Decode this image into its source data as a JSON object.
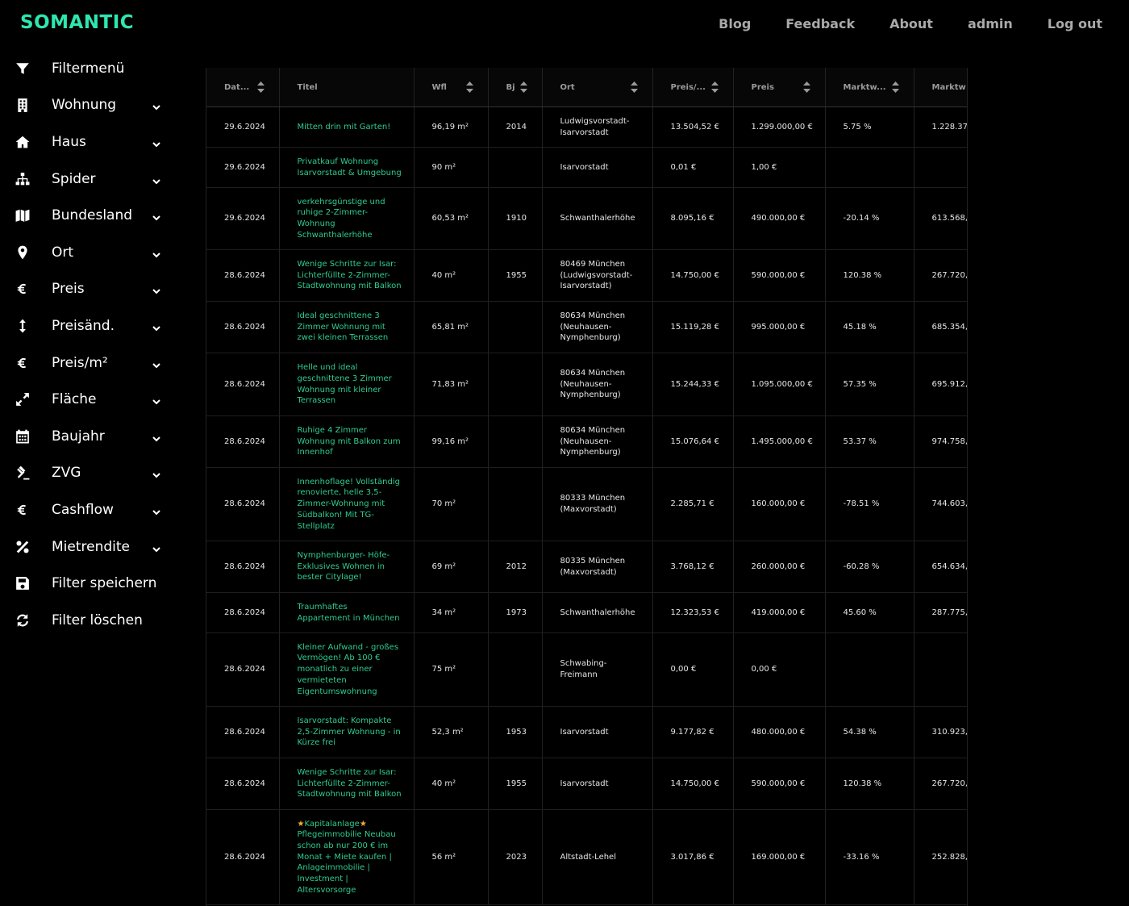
{
  "brand": "SOMANTIC",
  "nav": [
    "Blog",
    "Feedback",
    "About",
    "admin",
    "Log out"
  ],
  "sidebar": [
    {
      "label": "Filtermenü",
      "icon": "filter-icon",
      "chevron": false
    },
    {
      "label": "Wohnung",
      "icon": "building-icon",
      "chevron": true
    },
    {
      "label": "Haus",
      "icon": "home-icon",
      "chevron": true
    },
    {
      "label": "Spider",
      "icon": "sitemap-icon",
      "chevron": true
    },
    {
      "label": "Bundesland",
      "icon": "map-icon",
      "chevron": true
    },
    {
      "label": "Ort",
      "icon": "map-pin-icon",
      "chevron": true
    },
    {
      "label": "Preis",
      "icon": "euro-icon",
      "chevron": true
    },
    {
      "label": "Preisänd.",
      "icon": "arrows-vertical-icon",
      "chevron": true
    },
    {
      "label": "Preis/m²",
      "icon": "euro-icon",
      "chevron": true
    },
    {
      "label": "Fläche",
      "icon": "expand-icon",
      "chevron": true
    },
    {
      "label": "Baujahr",
      "icon": "calendar-icon",
      "chevron": true
    },
    {
      "label": "ZVG",
      "icon": "gavel-icon",
      "chevron": true
    },
    {
      "label": "Cashflow",
      "icon": "euro-icon",
      "chevron": true
    },
    {
      "label": "Mietrendite",
      "icon": "percent-icon",
      "chevron": true
    },
    {
      "label": "Filter speichern",
      "icon": "save-icon",
      "chevron": false
    },
    {
      "label": "Filter löschen",
      "icon": "refresh-icon",
      "chevron": false
    }
  ],
  "table": {
    "columns": [
      {
        "label": "Dat...",
        "sortable": true
      },
      {
        "label": "Titel",
        "sortable": false
      },
      {
        "label": "Wfl",
        "sortable": true
      },
      {
        "label": "Bj",
        "sortable": true
      },
      {
        "label": "Ort",
        "sortable": true
      },
      {
        "label": "Preis/...",
        "sortable": true
      },
      {
        "label": "Preis",
        "sortable": true
      },
      {
        "label": "Marktw...",
        "sortable": true
      },
      {
        "label": "Marktw",
        "sortable": false
      }
    ],
    "rows": [
      [
        "29.6.2024",
        "Mitten drin mit Garten!",
        "96,19 m²",
        "2014",
        "Ludwigsvorstadt-Isarvorstadt",
        "13.504,52 €",
        "1.299.000,00 €",
        "5.75 %",
        "1.228.37"
      ],
      [
        "29.6.2024",
        "Privatkauf Wohnung Isarvorstadt & Umgebung",
        "90 m²",
        "",
        "Isarvorstadt",
        "0,01 €",
        "1,00 €",
        "",
        ""
      ],
      [
        "29.6.2024",
        "verkehrsgünstige und ruhige 2-Zimmer-Wohnung Schwanthalerhöhe",
        "60,53 m²",
        "1910",
        "Schwanthalerhöhe",
        "8.095,16 €",
        "490.000,00 €",
        "-20.14 %",
        "613.568,"
      ],
      [
        "28.6.2024",
        "Wenige Schritte zur Isar: Lichterfüllte 2-Zimmer-Stadtwohnung mit Balkon",
        "40 m²",
        "1955",
        "80469 München (Ludwigsvorstadt-Isarvorstadt)",
        "14.750,00 €",
        "590.000,00 €",
        "120.38 %",
        "267.720,"
      ],
      [
        "28.6.2024",
        "Ideal geschnittene 3 Zimmer Wohnung mit zwei kleinen Terrassen",
        "65,81 m²",
        "",
        "80634 München (Neuhausen-Nymphenburg)",
        "15.119,28 €",
        "995.000,00 €",
        "45.18 %",
        "685.354,"
      ],
      [
        "28.6.2024",
        "Helle und ideal geschnittene 3 Zimmer Wohnung mit kleiner Terrassen",
        "71,83 m²",
        "",
        "80634 München (Neuhausen-Nymphenburg)",
        "15.244,33 €",
        "1.095.000,00 €",
        "57.35 %",
        "695.912,"
      ],
      [
        "28.6.2024",
        "Ruhige 4 Zimmer Wohnung mit Balkon zum Innenhof",
        "99,16 m²",
        "",
        "80634 München (Neuhausen-Nymphenburg)",
        "15.076,64 €",
        "1.495.000,00 €",
        "53.37 %",
        "974.758,"
      ],
      [
        "28.6.2024",
        "Innenhoflage! Vollständig renovierte, helle 3,5-Zimmer-Wohnung mit Südbalkon! Mit TG-Stellplatz",
        "70 m²",
        "",
        "80333 München (Maxvorstadt)",
        "2.285,71 €",
        "160.000,00 €",
        "-78.51 %",
        "744.603,"
      ],
      [
        "28.6.2024",
        "Nymphenburger- Höfe- Exklusives Wohnen in bester Citylage!",
        "69 m²",
        "2012",
        "80335 München (Maxvorstadt)",
        "3.768,12 €",
        "260.000,00 €",
        "-60.28 %",
        "654.634,"
      ],
      [
        "28.6.2024",
        "Traumhaftes Appartement in München",
        "34 m²",
        "1973",
        "Schwanthalerhöhe",
        "12.323,53 €",
        "419.000,00 €",
        "45.60 %",
        "287.775,"
      ],
      [
        "28.6.2024",
        "Kleiner Aufwand - großes Vermögen! Ab 100 € monatlich zu einer vermieteten Eigentumswohnung",
        "75 m²",
        "",
        "Schwabing-Freimann",
        "0,00 €",
        "0,00 €",
        "",
        ""
      ],
      [
        "28.6.2024",
        "Isarvorstadt: Kompakte 2,5-Zimmer Wohnung - in Kürze frei",
        "52,3 m²",
        "1953",
        "Isarvorstadt",
        "9.177,82 €",
        "480.000,00 €",
        "54.38 %",
        "310.923,"
      ],
      [
        "28.6.2024",
        "Wenige Schritte zur Isar: Lichterfüllte 2-Zimmer-Stadtwohnung mit Balkon",
        "40 m²",
        "1955",
        "Isarvorstadt",
        "14.750,00 €",
        "590.000,00 €",
        "120.38 %",
        "267.720,"
      ],
      [
        "28.6.2024",
        "★Kapitalanlage★ Pflegeimmobilie Neubau schon ab nur 200 € im Monat + Miete kaufen | Anlageimmobilie | Investment | Altersvorsorge",
        "56 m²",
        "2023",
        "Altstadt-Lehel",
        "3.017,86 €",
        "169.000,00 €",
        "-33.16 %",
        "252.828,"
      ]
    ]
  }
}
